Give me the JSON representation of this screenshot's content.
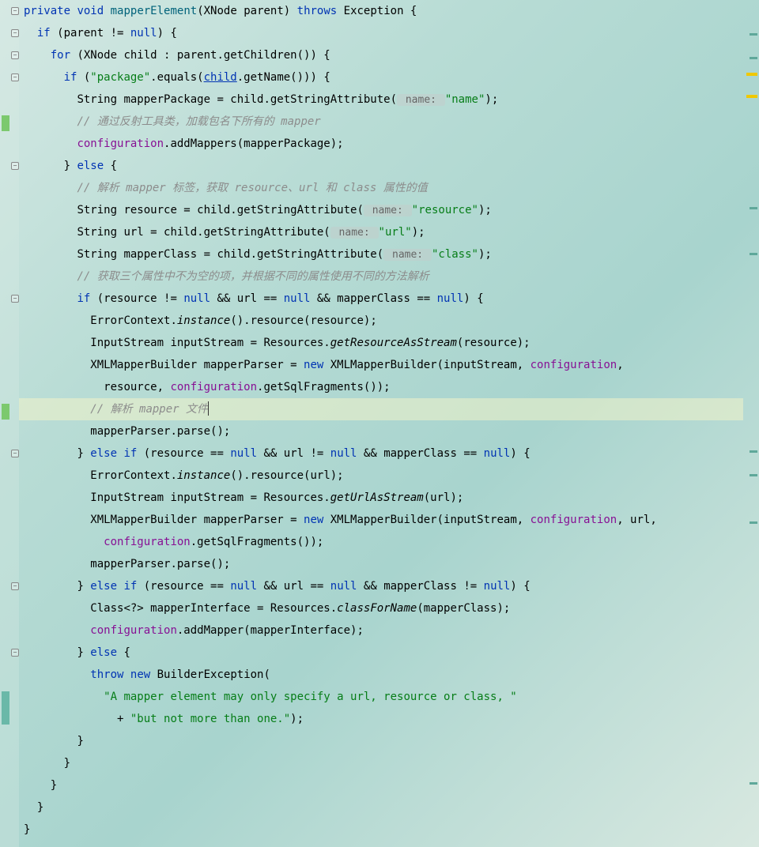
{
  "code": {
    "l1_private": "private",
    "l1_void": "void",
    "l1_method": "mapperElement",
    "l1_paren_open": "(",
    "l1_type": "XNode",
    "l1_param": " parent) ",
    "l1_throws": "throws",
    "l1_exc": " Exception {",
    "l2_if": "if",
    "l2_rest": " (parent != ",
    "l2_null": "null",
    "l2_close": ") {",
    "l3_for": "for",
    "l3_rest": " (XNode child : parent.getChildren()) {",
    "l4_if": "if",
    "l4_open": " (",
    "l4_str": "\"package\"",
    "l4_eq": ".equals(",
    "l4_child": "child",
    "l4_getname": ".getName())) {",
    "l5_pre": "String mapperPackage = child.getStringAttribute(",
    "l5_hint": " name: ",
    "l5_str": "\"name\"",
    "l5_end": ");",
    "l6_comment": "// 通过反射工具类，加载包名下所有的 mapper",
    "l7_field": "configuration",
    "l7_rest": ".addMappers(mapperPackage);",
    "l8_close": "} ",
    "l8_else": "else",
    "l8_brace": " {",
    "l9_comment": "// 解析 mapper 标签，获取 resource、url 和 class 属性的值",
    "l10_pre": "String resource = child.getStringAttribute(",
    "l10_hint": " name: ",
    "l10_str": "\"resource\"",
    "l10_end": ");",
    "l11_pre": "String url = child.getStringAttribute(",
    "l11_hint": " name: ",
    "l11_str": "\"url\"",
    "l11_end": ");",
    "l12_pre": "String mapperClass = child.getStringAttribute(",
    "l12_hint": " name: ",
    "l12_str": "\"class\"",
    "l12_end": ");",
    "l13_comment": "// 获取三个属性中不为空的项，并根据不同的属性使用不同的方法解析",
    "l14_if": "if",
    "l14_a": " (resource != ",
    "l14_null1": "null",
    "l14_b": " && url == ",
    "l14_null2": "null",
    "l14_c": " && mapperClass == ",
    "l14_null3": "null",
    "l14_d": ") {",
    "l15_a": "ErrorContext.",
    "l15_inst": "instance",
    "l15_b": "().resource(resource);",
    "l16_a": "InputStream inputStream = Resources.",
    "l16_m": "getResourceAsStream",
    "l16_b": "(resource);",
    "l17_a": "XMLMapperBuilder mapperParser = ",
    "l17_new": "new",
    "l17_b": " XMLMapperBuilder(inputStream, ",
    "l17_field": "configuration",
    "l17_c": ",",
    "l18_a": "  resource, ",
    "l18_field": "configuration",
    "l18_b": ".getSqlFragments());",
    "l19_comment": "// 解析 mapper 文件",
    "l20": "mapperParser.parse();",
    "l21_a": "} ",
    "l21_elseif": "else if",
    "l21_b": " (resource == ",
    "l21_null1": "null",
    "l21_c": " && url != ",
    "l21_null2": "null",
    "l21_d": " && mapperClass == ",
    "l21_null3": "null",
    "l21_e": ") {",
    "l22_a": "ErrorContext.",
    "l22_inst": "instance",
    "l22_b": "().resource(url);",
    "l23_a": "InputStream inputStream = Resources.",
    "l23_m": "getUrlAsStream",
    "l23_b": "(url);",
    "l24_a": "XMLMapperBuilder mapperParser = ",
    "l24_new": "new",
    "l24_b": " XMLMapperBuilder(inputStream, ",
    "l24_field": "configuration",
    "l24_c": ", url,",
    "l25_a": "  ",
    "l25_field": "configuration",
    "l25_b": ".getSqlFragments());",
    "l26": "mapperParser.parse();",
    "l27_a": "} ",
    "l27_elseif": "else if",
    "l27_b": " (resource == ",
    "l27_null1": "null",
    "l27_c": " && url == ",
    "l27_null2": "null",
    "l27_d": " && mapperClass != ",
    "l27_null3": "null",
    "l27_e": ") {",
    "l28_a": "Class<?> mapperInterface = Resources.",
    "l28_m": "classForName",
    "l28_b": "(mapperClass);",
    "l29_field": "configuration",
    "l29_rest": ".addMapper(mapperInterface);",
    "l30_a": "} ",
    "l30_else": "else",
    "l30_b": " {",
    "l31_throw": "throw",
    "l31_sp": " ",
    "l31_new": "new",
    "l31_rest": " BuilderException(",
    "l32_str": "\"A mapper element may only specify a url, resource or class, \"",
    "l33_plus": "+ ",
    "l33_str": "\"but not more than one.\"",
    "l33_end": ");",
    "l34": "}",
    "l35": "}",
    "l36": "}",
    "l37": "}",
    "l38": "}"
  },
  "indent": {
    "i1": "  ",
    "i2": "    ",
    "i3": "      ",
    "i4": "        ",
    "i5": "          ",
    "i6": "            ",
    "i7": "              "
  }
}
